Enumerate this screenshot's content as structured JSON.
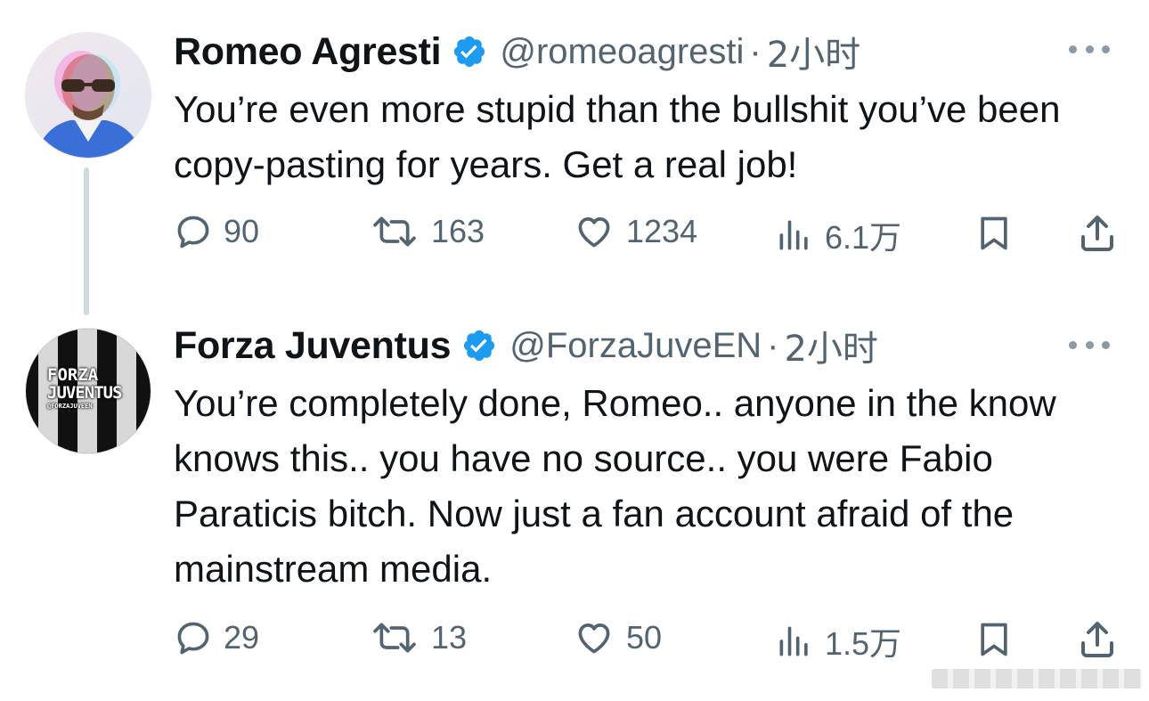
{
  "tweets": [
    {
      "name": "Romeo Agresti",
      "handle": "@romeoagresti",
      "separator": "·",
      "time": "2小时",
      "text": "You’re even more stupid than the bullshit you’ve been copy-pasting for years. Get a real job!",
      "replies": "90",
      "retweets": "163",
      "likes": "1234",
      "views": "6.1万"
    },
    {
      "name": "Forza Juventus",
      "handle": "@ForzaJuveEN",
      "separator": "·",
      "time": "2小时",
      "text": "You’re completely done, Romeo.. anyone in the know knows this.. you have no source.. you were Fabio Paraticis bitch. Now just a fan account afraid of the mainstream media.",
      "replies": "29",
      "retweets": "13",
      "likes": "50",
      "views": "1.5万",
      "avatar_logo_line1": "FORZA",
      "avatar_logo_line2": "JUVENTUS",
      "avatar_logo_handle": "@FORZAJUVEEN"
    }
  ],
  "colors": {
    "text": "#0f1419",
    "muted": "#536471",
    "verified": "#1d9bf0",
    "thread_line": "#cfd9de"
  },
  "icons": [
    "reply-icon",
    "retweet-icon",
    "like-icon",
    "views-icon",
    "bookmark-icon",
    "share-icon",
    "more-icon",
    "verified-badge-icon"
  ]
}
